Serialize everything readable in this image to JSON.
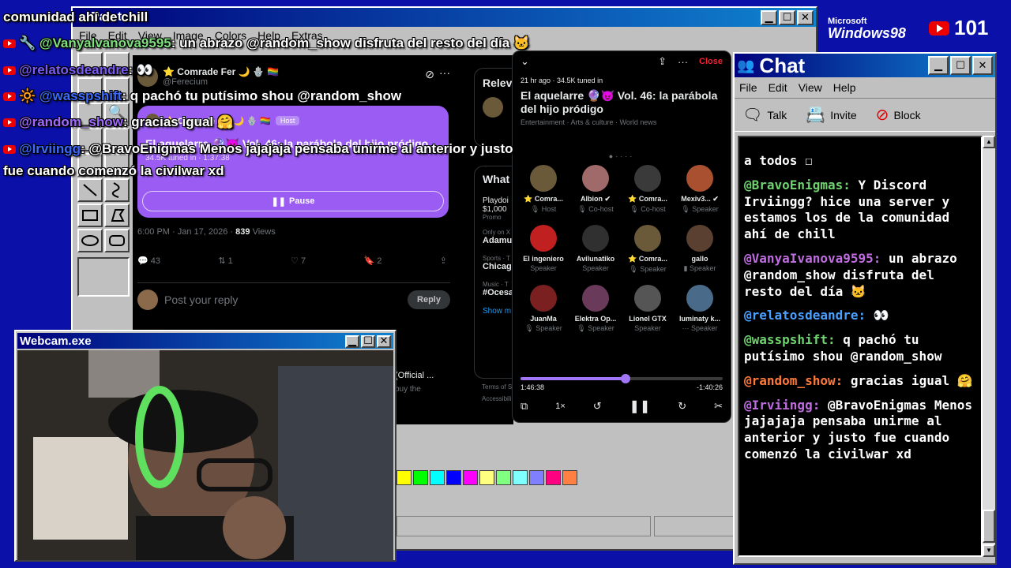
{
  "stream_overlay": {
    "youtube_count": "101",
    "win_logo_brand": "Microsoft",
    "win_logo_name": "Windows98",
    "lines": [
      {
        "text": "comunidad ahí de chill"
      },
      {
        "user": "@Vanyalvanova9595",
        "msg": ": un abrazo @random_show disfruta del resto del día 🐱"
      },
      {
        "user": "@relatosdeandre",
        "msg": ": 👀"
      },
      {
        "user": "@wasspshift",
        "msg": ": q pachó tu putísimo shou @random_show"
      },
      {
        "user": "@random_show",
        "msg": ": gracias igual 🤗"
      },
      {
        "user": "@Irviingg",
        "msg": ": @BravoEnigmas Menos jajajaja pensaba unirme al anterior y justo"
      },
      {
        "text": "fue cuando comenzó la civilwar xd"
      }
    ]
  },
  "paint": {
    "title": "Paint",
    "menu": [
      "File",
      "Edit",
      "View",
      "Image",
      "Colors",
      "Help",
      "Extras"
    ],
    "palette": [
      "#ffff00",
      "#00ff00",
      "#00ffff",
      "#0000ff",
      "#ff00ff",
      "#ffff80",
      "#80ff80",
      "#80ffff",
      "#8080ff",
      "#ff0080",
      "#ff8040"
    ]
  },
  "tweet": {
    "author": "⭐ Comrade Fer 🌙 🪬 🏳️‍🌈",
    "handle": "@Ferecium",
    "card_author": "⭐ Comrade Fer 🌙 🪬 🏳️‍🌈",
    "card_badge": "Host",
    "card_title": "El aquelarre 🔮😈 Vol. 46: la parábola del hijo pródigo",
    "card_meta": "34.5K tuned in · 1:37:38",
    "pause_label": "Pause",
    "time": "6:00 PM · Jan 17, 2026 ·",
    "views": "839",
    "views_label": "Views",
    "replies": "43",
    "retweets": "1",
    "likes": "7",
    "bookmarks": "2",
    "reply_placeholder": "Post your reply",
    "reply_button": "Reply",
    "right_heading": "Relev",
    "whats_heading": "What",
    "trends": [
      {
        "cat": "Playdoi",
        "name": "$1,000",
        "sub": "Promo"
      },
      {
        "cat": "Only on X",
        "name": "Adamu"
      },
      {
        "cat": "Sports · T",
        "name": "Chicag"
      },
      {
        "cat": "Music · T",
        "name": "#Ocesa"
      }
    ],
    "show_more": "Show m",
    "footer": "Terms of S",
    "footer2": "Accessibili",
    "video_title": "(Official ...",
    "video_sub": "buy the"
  },
  "space": {
    "close": "Close",
    "meta": "21 hr ago · 34.5K tuned in",
    "title": "El aquelarre 🔮😈 Vol. 46: la parábola del hijo pródigo",
    "tags": "Entertainment · Arts & culture · World news",
    "participants": [
      {
        "name": "⭐ Comra...",
        "role": "🎙 Host",
        "color": "#6b5a3a"
      },
      {
        "name": "Albion ✔",
        "role": "🎙 Co-host",
        "color": "#a06a6a"
      },
      {
        "name": "⭐ Comra...",
        "role": "🎙 Co-host",
        "color": "#3a3a3a"
      },
      {
        "name": "Mexiv3... ✔",
        "role": "🎙 Speaker",
        "color": "#a85030"
      },
      {
        "name": "El ingeniero",
        "role": "Speaker",
        "color": "#c02020"
      },
      {
        "name": "Avilunatiko",
        "role": "Speaker",
        "color": "#303030"
      },
      {
        "name": "⭐ Comra...",
        "role": "🎙 Speaker",
        "color": "#6b5a3a"
      },
      {
        "name": "gallo",
        "role": "▮ Speaker",
        "color": "#5a4030"
      },
      {
        "name": "JuanMa",
        "role": "🎙 Speaker",
        "color": "#7a2020"
      },
      {
        "name": "Elektra Op...",
        "role": "🎙 Speaker",
        "color": "#6a3a5a"
      },
      {
        "name": "Lionel GTX",
        "role": "Speaker",
        "color": "#555"
      },
      {
        "name": "luminaty k...",
        "role": "··· Speaker",
        "color": "#4a6a8a"
      }
    ],
    "progress": 0.52,
    "time_elapsed": "1:46:38",
    "time_remaining": "-1:40:26",
    "speed": "1×"
  },
  "webcam": {
    "title": "Webcam.exe"
  },
  "chat": {
    "title": "Chat",
    "menu": [
      "File",
      "Edit",
      "View",
      "Help"
    ],
    "tools": [
      {
        "label": "Talk"
      },
      {
        "label": "Invite"
      },
      {
        "label": "Block"
      }
    ],
    "messages": [
      {
        "user": "",
        "text": "a todos ☐"
      },
      {
        "user": "@BravoEnigmas:",
        "color": "#6fd36f",
        "text": " Y Discord Irviingg? hice una server y estamos los de la comunidad ahí de chill"
      },
      {
        "user": "@VanyaIvanova9595:",
        "color": "#c06de0",
        "text": " un abrazo @random_show disfruta del resto del día 🐱"
      },
      {
        "user": "@relatosdeandre:",
        "color": "#4aa0ff",
        "text": " 👀"
      },
      {
        "user": "@wasspshift:",
        "color": "#6fd36f",
        "text": " q pachó tu putísimo shou @random_show"
      },
      {
        "user": "@random_show:",
        "color": "#ff7a3a",
        "text": " gracias igual 🤗"
      },
      {
        "user": "@Irviingg:",
        "color": "#c06de0",
        "text": " @BravoEnigmas Menos jajajaja pensaba unirme al anterior y justo fue cuando comenzó la civilwar xd"
      }
    ]
  }
}
